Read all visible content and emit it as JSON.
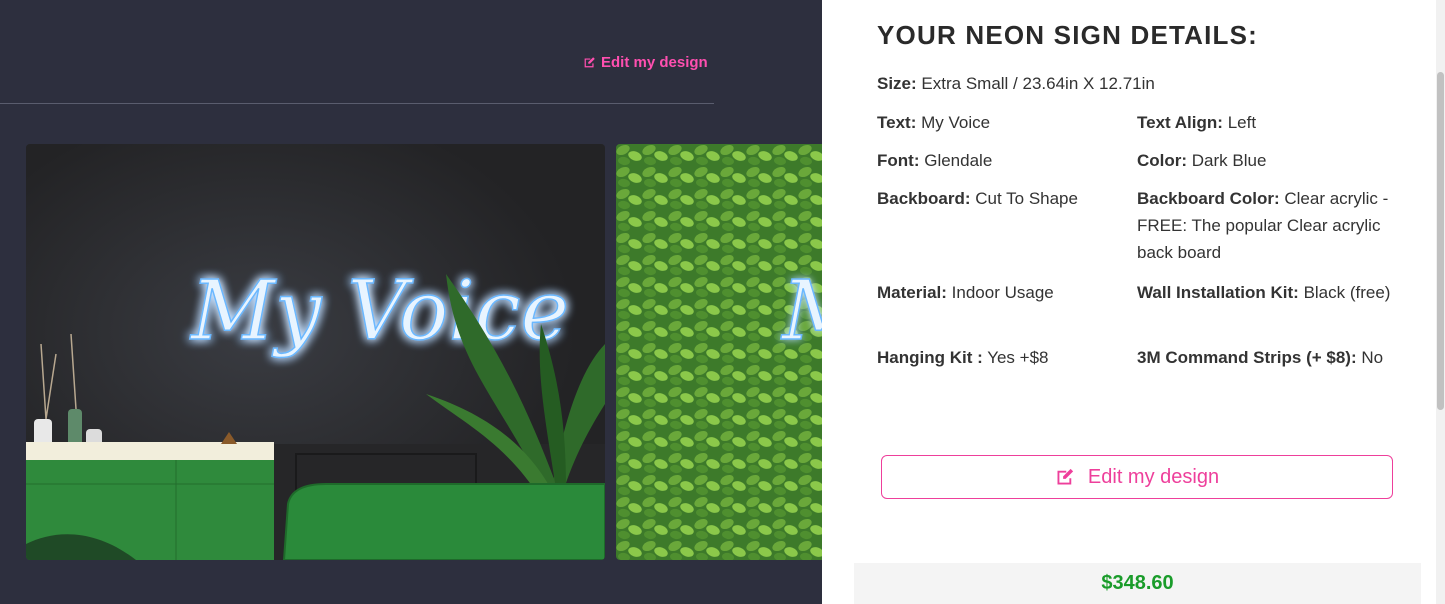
{
  "left": {
    "edit_link_label": "Edit my design",
    "sign_text": "My Voice",
    "sign_text_partial": "M"
  },
  "panel": {
    "title": "YOUR NEON SIGN DETAILS:",
    "details": {
      "size_label": "Size:",
      "size_value": "Extra Small / 23.64in X 12.71in",
      "text_label": "Text:",
      "text_value": "My Voice",
      "align_label": "Text Align:",
      "align_value": "Left",
      "font_label": "Font:",
      "font_value": "Glendale",
      "color_label": "Color:",
      "color_value": "Dark Blue",
      "backboard_label": "Backboard:",
      "backboard_value": "Cut To Shape",
      "backboard_color_label": "Backboard Color:",
      "backboard_color_value": "Clear acrylic - FREE: The popular Clear acrylic back board",
      "material_label": "Material:",
      "material_value": "Indoor Usage",
      "wall_kit_label": "Wall Installation Kit:",
      "wall_kit_value": "Black (free)",
      "hanging_kit_label": "Hanging Kit :",
      "hanging_kit_value": "Yes +$8",
      "command_strips_label": "3M Command Strips (+ $8):",
      "command_strips_value": "No"
    },
    "edit_button_label": "Edit my design",
    "price": "$348.60"
  },
  "colors": {
    "background": "#2d2f3e",
    "accent_pink": "#ee3f9b",
    "price_green": "#1a9c2a",
    "neon_blue": "#4aa8ff"
  }
}
